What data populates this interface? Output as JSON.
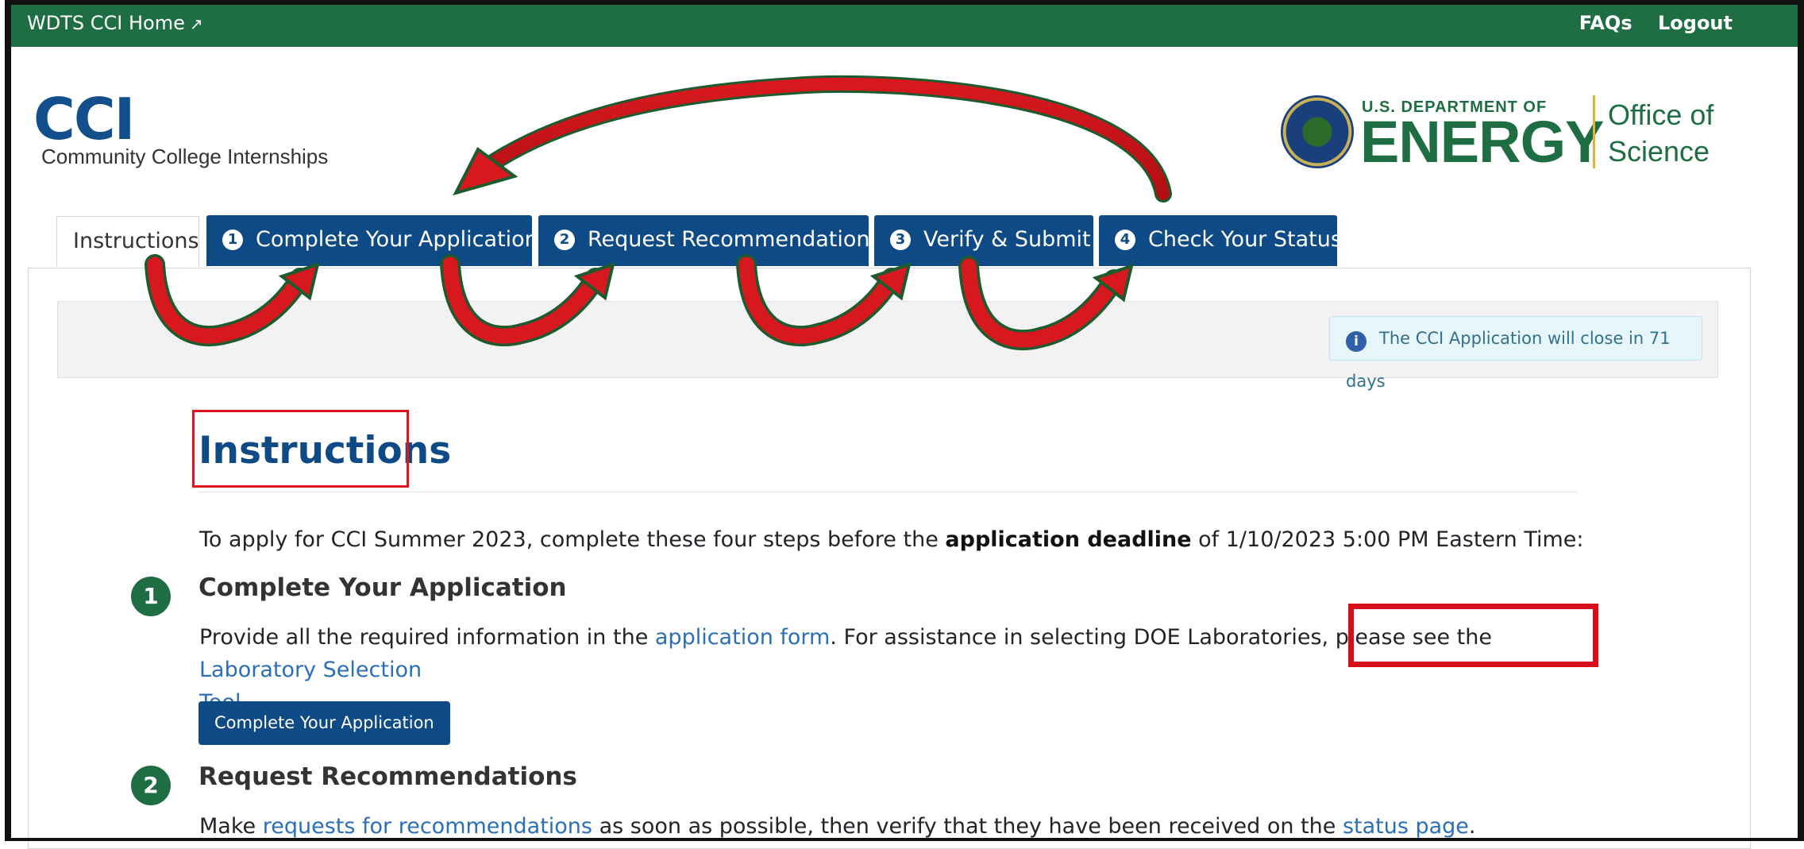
{
  "topbar": {
    "home_label": "WDTS CCI Home",
    "home_icon": "external-link-icon",
    "faqs_label": "FAQs",
    "logout_label": "Logout"
  },
  "brand": {
    "cci_logo_text": "CCI",
    "cci_subtitle": "Community College Internships",
    "doe_small": "U.S. DEPARTMENT OF",
    "doe_big": "ENERGY",
    "office_line1": "Office of",
    "office_line2": "Science"
  },
  "tabs": [
    {
      "label": "Instructions",
      "num": ""
    },
    {
      "label": "Complete Your Application",
      "num": "1"
    },
    {
      "label": "Request Recommendations",
      "num": "2"
    },
    {
      "label": "Verify & Submit",
      "num": "3"
    },
    {
      "label": "Check Your Status",
      "num": "4"
    }
  ],
  "alert": {
    "icon": "info-icon",
    "text": "The CCI Application will close in 71 days"
  },
  "content": {
    "heading": "Instructions",
    "intro_before": "To apply for CCI Summer 2023, complete these four steps before the ",
    "intro_bold": "application deadline",
    "intro_after": " of 1/10/2023 5:00 PM Eastern Time:",
    "step1": {
      "num": "1",
      "title": "Complete Your Application",
      "text_before": "Provide all the required information in the ",
      "link1": "application form",
      "text_middle": ". For assistance in selecting DOE Laboratories, please see the ",
      "link2a": "Laboratory Selection",
      "link2b": "Tool",
      "text_end": ".",
      "button": "Complete Your Application"
    },
    "step2": {
      "num": "2",
      "title": "Request Recommendations",
      "text_before": "Make ",
      "link1": "requests for recommendations",
      "text_middle": " as soon as possible, then verify that they have been received on the ",
      "link2": "status page",
      "text_end": "."
    }
  },
  "colors": {
    "nav_green": "#1f6e43",
    "tab_blue": "#0e4a86",
    "link_blue": "#2a6fb7",
    "annotation_red": "#e0141c"
  }
}
